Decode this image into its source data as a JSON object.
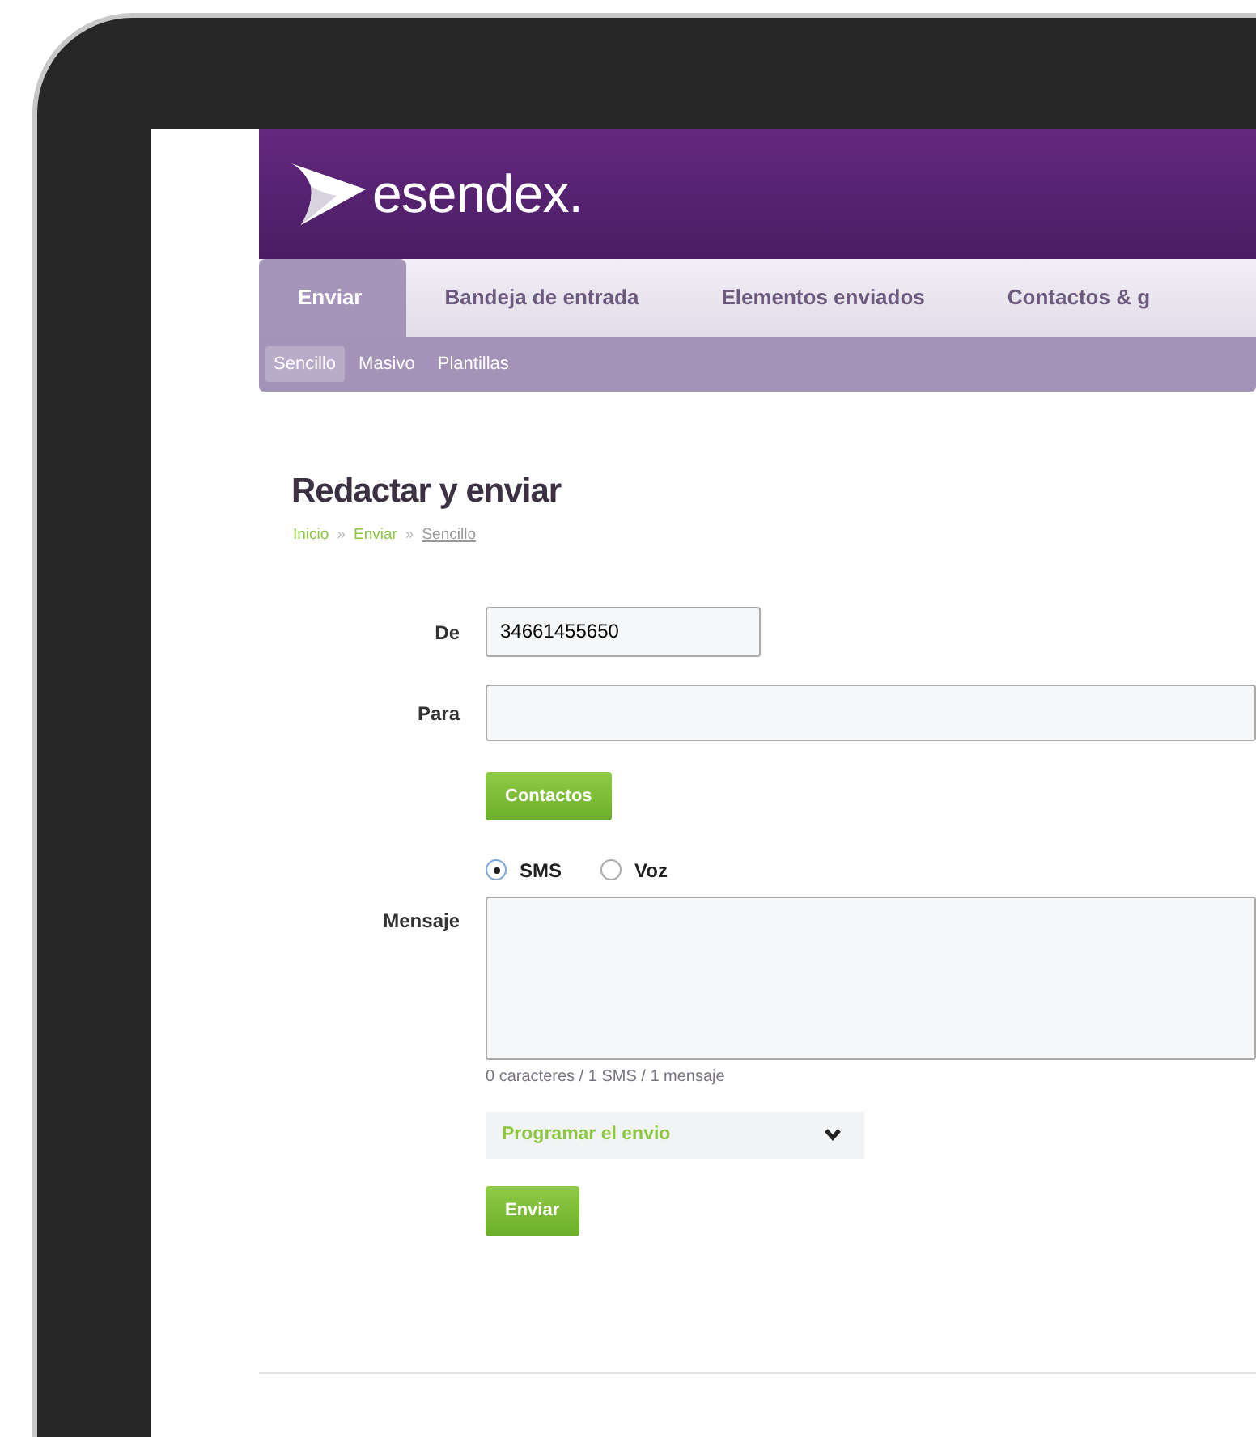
{
  "header": {
    "logo_text": "esendex."
  },
  "tabs": [
    {
      "label": "Enviar",
      "selected": true
    },
    {
      "label": "Bandeja de entrada",
      "selected": false
    },
    {
      "label": "Elementos enviados",
      "selected": false
    },
    {
      "label": "Contactos & g",
      "selected": false
    }
  ],
  "subtabs": [
    {
      "label": "Sencillo",
      "selected": true
    },
    {
      "label": "Masivo",
      "selected": false
    },
    {
      "label": "Plantillas",
      "selected": false
    }
  ],
  "page": {
    "title": "Redactar y enviar",
    "breadcrumb": [
      {
        "label": "Inicio",
        "current": false
      },
      {
        "label": "Enviar",
        "current": false
      },
      {
        "label": "Sencillo",
        "current": true
      }
    ],
    "breadcrumb_separator": "»"
  },
  "form": {
    "from": {
      "label": "De",
      "value": "34661455650"
    },
    "to": {
      "label": "Para"
    },
    "contacts_button": "Contactos",
    "types": [
      {
        "label": "SMS",
        "selected": true
      },
      {
        "label": "Voz",
        "selected": false
      }
    ],
    "message": {
      "label": "Mensaje"
    },
    "counter": "0 caracteres / 1 SMS / 1 mensaje",
    "schedule": {
      "label": "Programar el envio",
      "expanded": false
    },
    "send_button": "Enviar"
  }
}
